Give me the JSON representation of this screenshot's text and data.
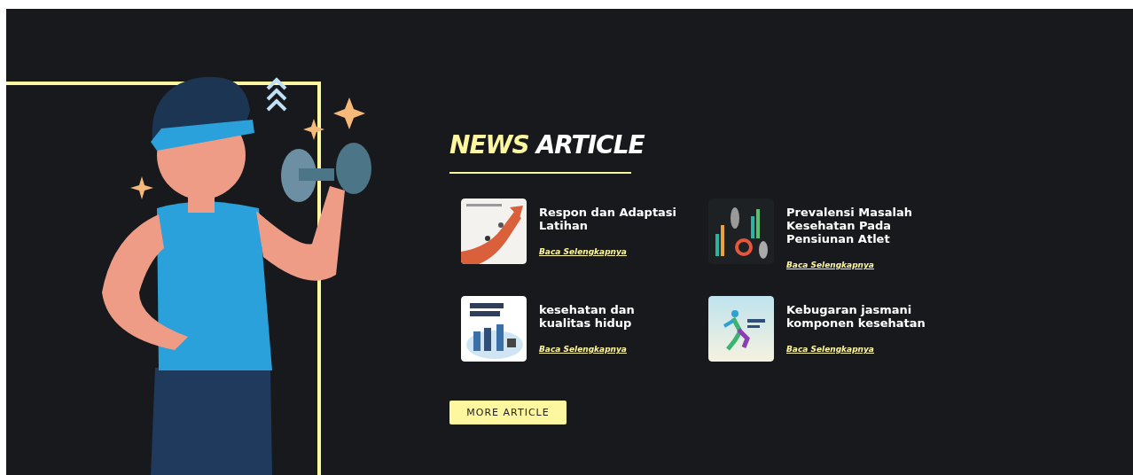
{
  "section": {
    "title_highlight": "NEWS",
    "title_rest": "ARTICLE"
  },
  "articles": [
    {
      "title": "Respon dan Adaptasi Latihan",
      "link": "Baca Selengkapnya"
    },
    {
      "title": "Prevalensi Masalah Kesehatan Pada Pensiunan Atlet",
      "link": "Baca Selengkapnya"
    },
    {
      "title": "kesehatan dan kualitas hidup",
      "link": "Baca Selengkapnya"
    },
    {
      "title": "Kebugaran jasmani komponen kesehatan",
      "link": "Baca Selengkapnya"
    }
  ],
  "button": {
    "label": "MORE ARTICLE"
  }
}
